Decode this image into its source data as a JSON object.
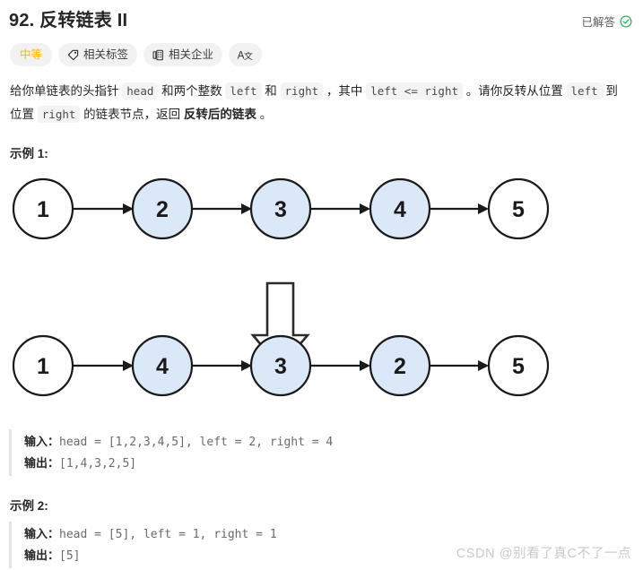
{
  "header": {
    "title": "92. 反转链表 II",
    "status_label": "已解答",
    "status_icon": "check-circle-icon",
    "status_color": "#2db55d"
  },
  "badges": [
    {
      "label": "中等",
      "icon": null,
      "kind": "difficulty",
      "color": "#ffb800"
    },
    {
      "label": "相关标签",
      "icon": "tag-icon",
      "kind": "normal"
    },
    {
      "label": "相关企业",
      "icon": "building-icon",
      "kind": "normal"
    },
    {
      "label": "",
      "icon": "translate-icon",
      "kind": "icon-only"
    }
  ],
  "description": {
    "seg1": "给你单链表的头指针 ",
    "code1": "head",
    "seg2": " 和两个整数 ",
    "code2": "left",
    "seg3": " 和 ",
    "code3": "right",
    "seg4": " ，其中 ",
    "code4": "left <= right",
    "seg5": " 。请你反转从位置 ",
    "code5": "left",
    "seg6": " 到位置 ",
    "code6": "right",
    "seg7": " 的链表节点，返回 ",
    "bold1": "反转后的链表",
    "seg8": " 。"
  },
  "examples": [
    {
      "title": "示例 1:",
      "input_label": "输入：",
      "input_value": "head = [1,2,3,4,5], left = 2, right = 4",
      "output_label": "输出：",
      "output_value": "[1,4,3,2,5]"
    },
    {
      "title": "示例 2:",
      "input_label": "输入：",
      "input_value": "head = [5], left = 1, right = 1",
      "output_label": "输出：",
      "output_value": "[5]"
    }
  ],
  "diagram": {
    "list_before": [
      {
        "value": "1",
        "highlighted": false
      },
      {
        "value": "2",
        "highlighted": true
      },
      {
        "value": "3",
        "highlighted": true
      },
      {
        "value": "4",
        "highlighted": true
      },
      {
        "value": "5",
        "highlighted": false
      }
    ],
    "list_after": [
      {
        "value": "1",
        "highlighted": false
      },
      {
        "value": "4",
        "highlighted": true
      },
      {
        "value": "3",
        "highlighted": true
      },
      {
        "value": "2",
        "highlighted": true
      },
      {
        "value": "5",
        "highlighted": false
      }
    ],
    "transform_arrow": "down-arrow-icon",
    "node_fill_highlight": "#dae8f8",
    "node_fill_plain": "#ffffff",
    "node_stroke": "#1a1a1a"
  },
  "watermark": "CSDN @别看了真C不了一点"
}
